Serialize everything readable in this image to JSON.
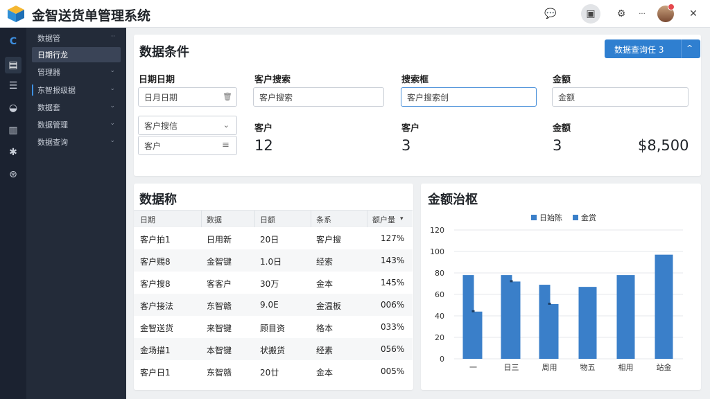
{
  "app": {
    "title": "金智送货单管理系统"
  },
  "titlebar": {
    "buttons": [
      {
        "icon": "feedback-icon",
        "glyph": "💬"
      },
      {
        "icon": "document-icon",
        "glyph": "▣"
      },
      {
        "icon": "settings-icon",
        "glyph": "⚙"
      },
      {
        "icon": "more-icon",
        "glyph": "···"
      },
      {
        "icon": "close-icon",
        "glyph": "✕"
      }
    ]
  },
  "rail": {
    "items": [
      {
        "icon": "brand-c-icon",
        "glyph": "C"
      },
      {
        "icon": "document-icon",
        "glyph": "▤"
      },
      {
        "icon": "list-icon",
        "glyph": "☰"
      },
      {
        "icon": "stack-icon",
        "glyph": "◒"
      },
      {
        "icon": "bar-chart-icon",
        "glyph": "▥"
      },
      {
        "icon": "gear-icon",
        "glyph": "✱"
      },
      {
        "icon": "help-icon",
        "glyph": "⊛"
      }
    ]
  },
  "sidebar": {
    "items": [
      {
        "label": "数据管",
        "chevron": "··"
      },
      {
        "label": "日期行龙",
        "chevron": ""
      },
      {
        "label": "管理器",
        "chevron": "⌄"
      },
      {
        "label": "东智报级据",
        "chevron": "⌄"
      },
      {
        "label": "数据套",
        "chevron": "⌄"
      },
      {
        "label": "数据管理",
        "chevron": "⌄"
      },
      {
        "label": "数据查询",
        "chevron": "⌄"
      }
    ]
  },
  "conditions": {
    "title": "数据条件",
    "query_button": {
      "label": "数据查询任 3",
      "arrow": "^"
    },
    "fields": [
      {
        "label": "日期日期",
        "value": "日月日期",
        "icon": "🗑"
      },
      {
        "label": "客户搜索",
        "value": "客户搜索"
      },
      {
        "label": "搜索框",
        "value": "客户搜索创"
      },
      {
        "label": "金额",
        "value": "金额"
      }
    ],
    "customer_select": {
      "value": "客户搜信",
      "arrow": "⌄"
    },
    "customer_input": {
      "value": "客户",
      "icon": "≡"
    },
    "stats": [
      {
        "label": "客户",
        "value": "12"
      },
      {
        "label": "客户",
        "value": "3"
      },
      {
        "label": "金额",
        "value": "3"
      }
    ],
    "total": "$8,500"
  },
  "table": {
    "title": "数据称",
    "columns": [
      "日期",
      "数据",
      "日额",
      "条系",
      "额户量"
    ],
    "rows": [
      [
        "客户拍1",
        "日用新",
        "20日",
        "客户搜",
        "127%"
      ],
      [
        "客户赐8",
        "金智键",
        "1.0日",
        "经索",
        "143%"
      ],
      [
        "客户搜8",
        "客客户",
        "30万",
        "金本",
        "145%"
      ],
      [
        "客户接法",
        "东智赣",
        "9.0E",
        "金温板",
        "006%"
      ],
      [
        "金智送货",
        "来智键",
        "顾目资",
        "格本",
        "033%"
      ],
      [
        "金场描1",
        "本智键",
        "状搬货",
        "经素",
        "056%"
      ],
      [
        "客户日1",
        "东智赣",
        "20廿",
        "金本",
        "005%"
      ]
    ]
  },
  "chart_data": {
    "type": "bar",
    "title": "金额治枢",
    "categories": [
      "一",
      "日三",
      "周用",
      "物五",
      "相用",
      "站金"
    ],
    "series": [
      {
        "name": "日始陈",
        "values": [
          78,
          78,
          69,
          67,
          78,
          97
        ]
      },
      {
        "name": "金赏",
        "values": [
          44,
          72,
          51,
          null,
          null,
          null
        ]
      }
    ],
    "ylim": [
      0,
      120
    ],
    "yticks": [
      0,
      20,
      40,
      60,
      80,
      100,
      120
    ],
    "legend": "top",
    "grid": true,
    "color": "#3a7fc9"
  }
}
